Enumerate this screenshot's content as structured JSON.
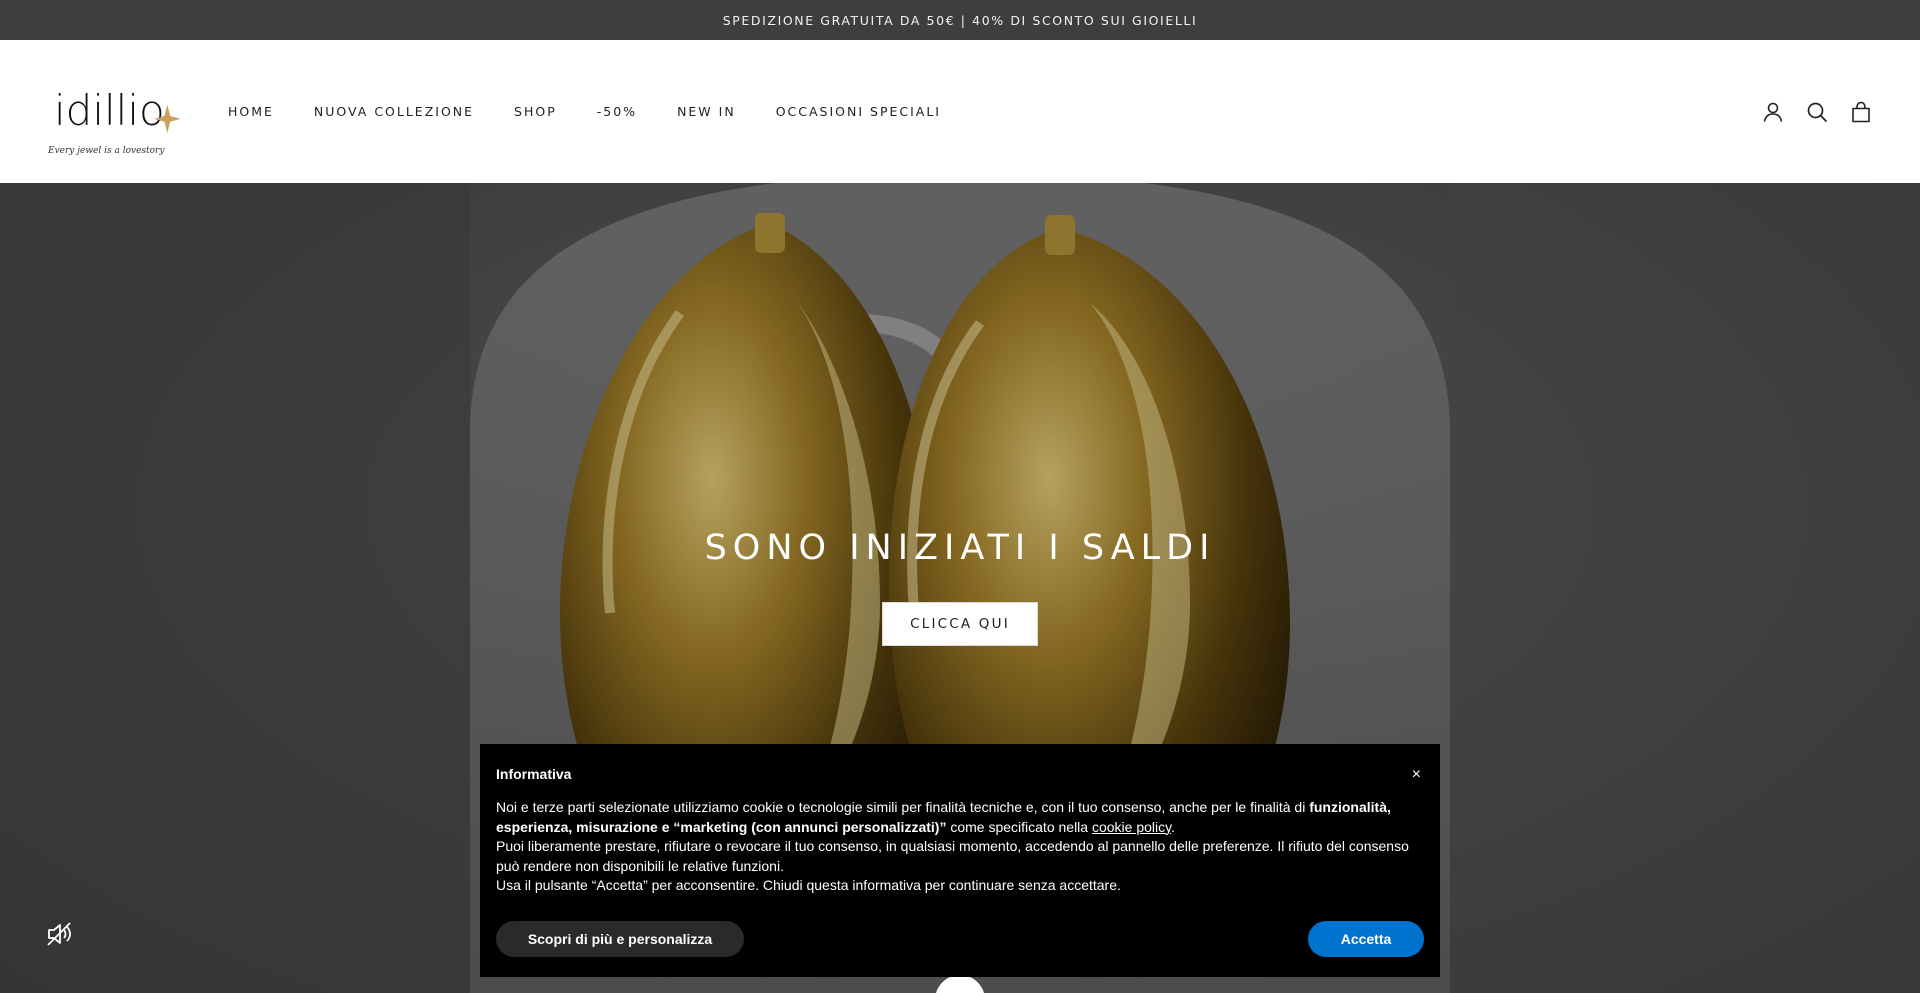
{
  "announcement": {
    "text": "SPEDIZIONE GRATUITA DA 50€ | 40% DI SCONTO SUI GIOIELLI"
  },
  "header": {
    "logo": {
      "wordmark": "idillio",
      "tagline": "Every jewel is a lovestory",
      "accent_color": "#c8a25a"
    },
    "nav": [
      {
        "label": "HOME"
      },
      {
        "label": "NUOVA COLLEZIONE"
      },
      {
        "label": "SHOP"
      },
      {
        "label": "-50%"
      },
      {
        "label": "NEW IN"
      },
      {
        "label": "OCCASIONI SPECIALI"
      }
    ],
    "icons": [
      "account-icon",
      "search-icon",
      "bag-icon"
    ]
  },
  "hero": {
    "title": "SONO INIZIATI I SALDI",
    "button_label": "CLICCA QUI",
    "image": "gold-hoop-earrings"
  },
  "cookie_banner": {
    "title": "Informativa",
    "close_label": "×",
    "p1_a": "Noi e terze parti selezionate utilizziamo cookie o tecnologie simili per finalità tecniche e, con il tuo consenso, anche per le finalità di ",
    "p1_b": "funzionalità, esperienza, misurazione e “marketing (con annunci personalizzati)”",
    "p1_c": " come specificato nella ",
    "p1_link": "cookie policy",
    "p1_d": ".",
    "p2": "Puoi liberamente prestare, rifiutare o revocare il tuo consenso, in qualsiasi momento, accedendo al pannello delle preferenze. Il rifiuto del consenso può rendere non disponibili le relative funzioni.",
    "p3": "Usa il pulsante “Accetta” per acconsentire. Chiudi questa informativa per continuare senza accettare.",
    "more_button": "Scopri di più e personalizza",
    "accept_button": "Accetta",
    "accept_color": "#0073ce"
  }
}
